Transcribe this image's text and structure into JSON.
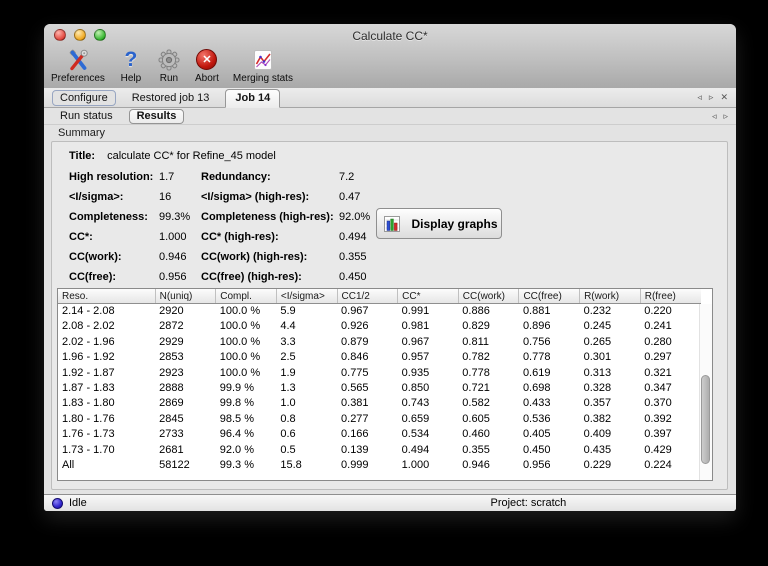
{
  "window": {
    "title": "Calculate CC*"
  },
  "toolbar": {
    "items": [
      {
        "id": "preferences",
        "label": "Preferences",
        "icon": "tools-icon"
      },
      {
        "id": "help",
        "label": "Help",
        "icon": "question-icon"
      },
      {
        "id": "run",
        "label": "Run",
        "icon": "gear-icon"
      },
      {
        "id": "abort",
        "label": "Abort",
        "icon": "abort-icon"
      },
      {
        "id": "merging-stats",
        "label": "Merging stats",
        "icon": "merging-stats-icon"
      }
    ]
  },
  "job_tabs": {
    "items": [
      {
        "id": "configure",
        "label": "Configure",
        "state": "outlined"
      },
      {
        "id": "restored-job-13",
        "label": "Restored job 13",
        "state": "plain"
      },
      {
        "id": "job-14",
        "label": "Job 14",
        "state": "selected"
      }
    ],
    "nav_left": "◃",
    "nav_right": "▹",
    "nav_close": "✕"
  },
  "result_tabs": {
    "items": [
      {
        "id": "run-status",
        "label": "Run status",
        "state": "plain"
      },
      {
        "id": "results",
        "label": "Results",
        "state": "selected-box"
      }
    ],
    "nav_left": "◃",
    "nav_right": "▹"
  },
  "section_label": "Summary",
  "summary": {
    "title_label": "Title:",
    "title_value": "calculate CC* for Refine_45 model",
    "stats": [
      {
        "label": "High resolution:",
        "value": "1.7",
        "label2": "Redundancy:",
        "value2": "7.2"
      },
      {
        "label": "<I/sigma>:",
        "value": "16",
        "label2": "<I/sigma> (high-res):",
        "value2": "0.47"
      },
      {
        "label": "Completeness:",
        "value": "99.3%",
        "label2": "Completeness (high-res):",
        "value2": "92.0%"
      },
      {
        "label": "CC*:",
        "value": "1.000",
        "label2": "CC* (high-res):",
        "value2": "0.494"
      },
      {
        "label": "CC(work):",
        "value": "0.946",
        "label2": "CC(work) (high-res):",
        "value2": "0.355"
      },
      {
        "label": "CC(free):",
        "value": "0.956",
        "label2": "CC(free) (high-res):",
        "value2": "0.450"
      }
    ],
    "display_graphs_label": "Display graphs"
  },
  "table": {
    "columns": [
      "Reso.",
      "N(uniq)",
      "Compl.",
      "<I/sigma>",
      "CC1/2",
      "CC*",
      "CC(work)",
      "CC(free)",
      "R(work)",
      "R(free)"
    ],
    "rows": [
      [
        "2.14 - 2.08",
        "2920",
        "100.0 %",
        "5.9",
        "0.967",
        "0.991",
        "0.886",
        "0.881",
        "0.232",
        "0.220"
      ],
      [
        "2.08 - 2.02",
        "2872",
        "100.0 %",
        "4.4",
        "0.926",
        "0.981",
        "0.829",
        "0.896",
        "0.245",
        "0.241"
      ],
      [
        "2.02 - 1.96",
        "2929",
        "100.0 %",
        "3.3",
        "0.879",
        "0.967",
        "0.811",
        "0.756",
        "0.265",
        "0.280"
      ],
      [
        "1.96 - 1.92",
        "2853",
        "100.0 %",
        "2.5",
        "0.846",
        "0.957",
        "0.782",
        "0.778",
        "0.301",
        "0.297"
      ],
      [
        "1.92 - 1.87",
        "2923",
        "100.0 %",
        "1.9",
        "0.775",
        "0.935",
        "0.778",
        "0.619",
        "0.313",
        "0.321"
      ],
      [
        "1.87 - 1.83",
        "2888",
        "99.9 %",
        "1.3",
        "0.565",
        "0.850",
        "0.721",
        "0.698",
        "0.328",
        "0.347"
      ],
      [
        "1.83 - 1.80",
        "2869",
        "99.8 %",
        "1.0",
        "0.381",
        "0.743",
        "0.582",
        "0.433",
        "0.357",
        "0.370"
      ],
      [
        "1.80 - 1.76",
        "2845",
        "98.5 %",
        "0.8",
        "0.277",
        "0.659",
        "0.605",
        "0.536",
        "0.382",
        "0.392"
      ],
      [
        "1.76 - 1.73",
        "2733",
        "96.4 %",
        "0.6",
        "0.166",
        "0.534",
        "0.460",
        "0.405",
        "0.409",
        "0.397"
      ],
      [
        "1.73 - 1.70",
        "2681",
        "92.0 %",
        "0.5",
        "0.139",
        "0.494",
        "0.355",
        "0.450",
        "0.435",
        "0.429"
      ],
      [
        "All",
        "58122",
        "99.3 %",
        "15.8",
        "0.999",
        "1.000",
        "0.946",
        "0.956",
        "0.229",
        "0.224"
      ]
    ]
  },
  "statusbar": {
    "status": "Idle",
    "project": "Project: scratch"
  },
  "colors": {
    "chrome_top": "#d8d8d8",
    "chrome_bottom": "#a9a9a9",
    "content_bg": "#e3e3e3",
    "panel_bg": "#e9e9e9",
    "table_bg": "#ffffff",
    "accent_blue": "#2a63cc",
    "abort_red": "#c1170d",
    "status_indicator": "#3226cf"
  }
}
